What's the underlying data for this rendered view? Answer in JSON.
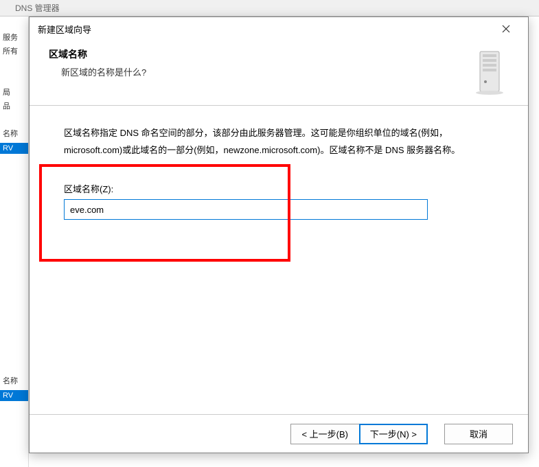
{
  "background": {
    "app_title": "DNS",
    "window_title": "DNS 管理器",
    "left_items_top": [
      "服务",
      "所有",
      "",
      "局",
      "品"
    ],
    "left_label_name": "名称",
    "left_selected": "RV",
    "left_bottom_name": "名称",
    "left_bottom_sel": "RV"
  },
  "dialog": {
    "title": "新建区域向导",
    "header": {
      "heading": "区域名称",
      "subtext": "新区域的名称是什么?"
    },
    "body": {
      "explain": "区域名称指定 DNS 命名空间的部分，该部分由此服务器管理。这可能是你组织单位的域名(例如，microsoft.com)或此域名的一部分(例如，newzone.microsoft.com)。区域名称不是 DNS 服务器名称。",
      "input_label": "区域名称(Z):",
      "input_value": "eve.com"
    },
    "footer": {
      "back": "< 上一步(B)",
      "next": "下一步(N) >",
      "cancel": "取消"
    }
  }
}
